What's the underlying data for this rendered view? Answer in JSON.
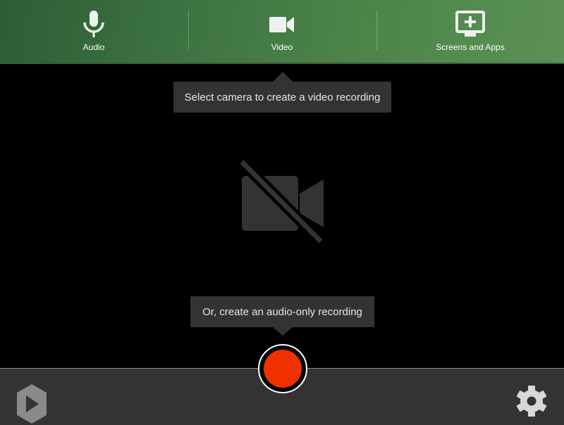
{
  "tabs": [
    {
      "label": "Audio",
      "icon": "microphone-icon"
    },
    {
      "label": "Video",
      "icon": "video-camera-icon"
    },
    {
      "label": "Screens and Apps",
      "icon": "screen-add-icon"
    }
  ],
  "selected_tab": "Video",
  "tooltips": {
    "camera": "Select camera to create a video recording",
    "audio": "Or, create an audio-only recording"
  },
  "colors": {
    "header_green": "#4d8549",
    "record_red": "#f03000",
    "toolbar": "#333333"
  }
}
